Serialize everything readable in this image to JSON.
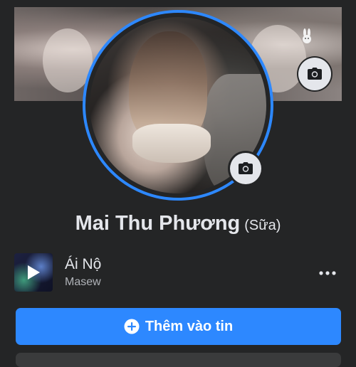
{
  "profile": {
    "name": "Mai Thu Phương",
    "nickname": "(Sữa)"
  },
  "music": {
    "title": "Ái Nộ",
    "artist": "Masew"
  },
  "actions": {
    "add_story_label": "Thêm vào tin"
  },
  "colors": {
    "background": "#242526",
    "accent": "#2d88ff",
    "text_primary": "#e4e6eb",
    "text_secondary": "#b0b3b8"
  },
  "icons": {
    "cover_camera": "camera-icon",
    "avatar_camera": "camera-icon",
    "album_play": "play-icon",
    "more": "more-horizontal-icon",
    "add": "plus-circle-icon"
  }
}
